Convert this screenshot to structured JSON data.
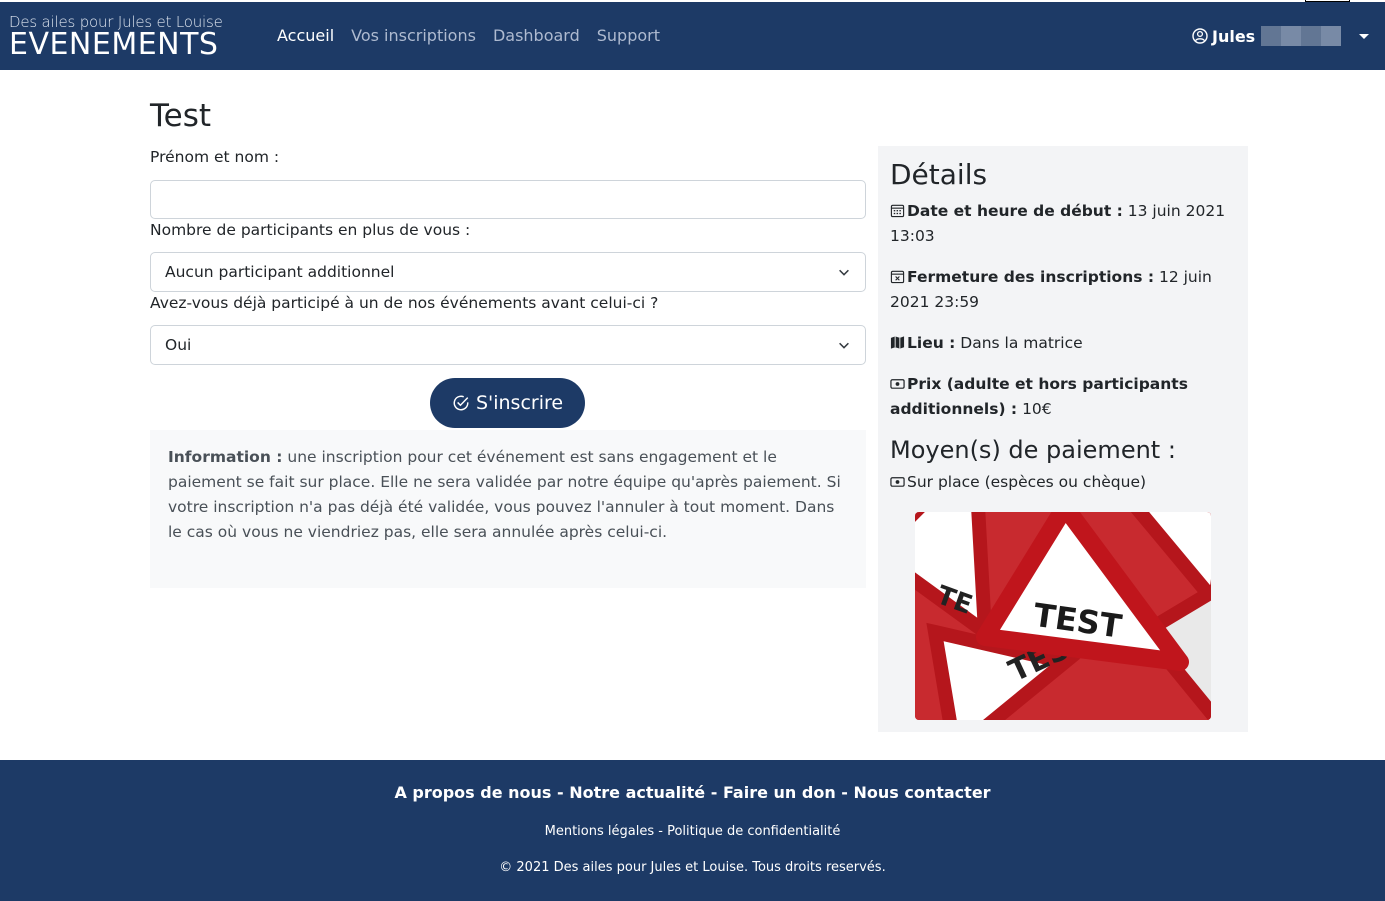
{
  "brand": {
    "small": "Des ailes pour Jules et Louise",
    "big": "EVENEMENTS"
  },
  "nav": {
    "items": [
      {
        "label": "Accueil",
        "active": true
      },
      {
        "label": "Vos inscriptions",
        "active": false
      },
      {
        "label": "Dashboard",
        "active": false
      },
      {
        "label": "Support",
        "active": false
      }
    ],
    "user_name": "Jules",
    "user_icon": "user-circle-icon"
  },
  "event": {
    "title": "Test"
  },
  "form": {
    "name_label": "Prénom et nom :",
    "name_value": "",
    "participants_label": "Nombre de participants en plus de vous :",
    "participants_selected": "Aucun participant additionnel",
    "previous_label": "Avez-vous déjà participé à un de nos événements avant celui-ci ?",
    "previous_selected": "Oui",
    "submit_label": "S'inscrire",
    "submit_icon": "check-circle-icon"
  },
  "info": {
    "title": "Information :",
    "text": " une inscription pour cet événement est sans engagement et le paiement se fait sur place. Elle ne sera validée par notre équipe qu'après paiement. Si votre inscription n'a pas déjà été validée, vous pouvez l'annuler à tout moment. Dans le cas où vous ne viendriez pas, elle sera annulée après celui-ci."
  },
  "details": {
    "title": "Détails",
    "start_label": "Date et heure de début :",
    "start_value": " 13 juin 2021 13:03",
    "close_label": "Fermeture des inscriptions :",
    "close_value": " 12 juin 2021 23:59",
    "place_label": "Lieu :",
    "place_value": " Dans la matrice",
    "price_label": "Prix (adulte et hors participants additionnels) :",
    "price_value": " 10€",
    "payment_title": "Moyen(s) de paiement :",
    "payment_method": "Sur place (espèces ou chèque)",
    "image_text_main": "TEST",
    "image_text_secondary": "TES"
  },
  "footer": {
    "links": [
      "A propos de nous",
      "Notre actualité",
      "Faire un don",
      "Nous contacter"
    ],
    "separator": " - ",
    "legal": [
      "Mentions légales",
      "Politique de confidentialité"
    ],
    "copyright": "© 2021 Des ailes pour Jules et Louise. Tous droits reservés."
  }
}
